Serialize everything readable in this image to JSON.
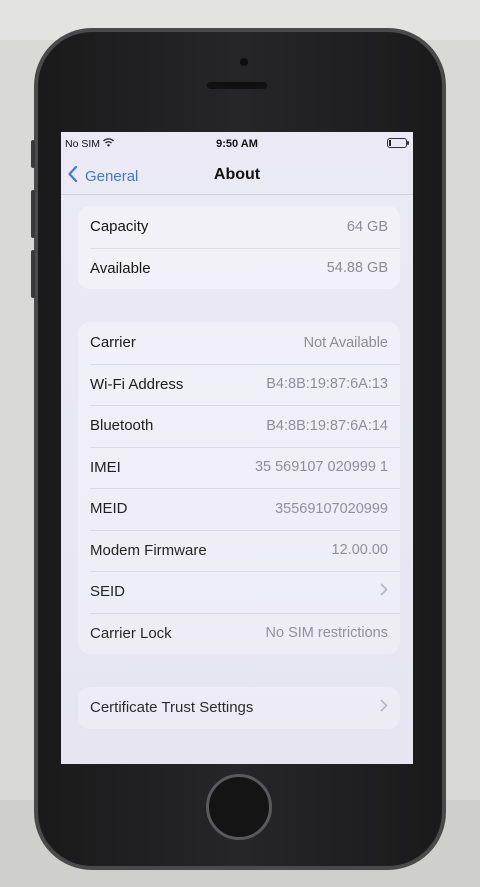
{
  "status_bar": {
    "carrier": "No SIM",
    "wifi_icon": "wifi-icon",
    "time": "9:50 AM",
    "battery_icon": "battery-icon"
  },
  "nav": {
    "back_label": "General",
    "title": "About"
  },
  "storage": [
    {
      "label": "Capacity",
      "value": "64 GB"
    },
    {
      "label": "Available",
      "value": "54.88 GB"
    }
  ],
  "network": [
    {
      "label": "Carrier",
      "value": "Not Available"
    },
    {
      "label": "Wi-Fi Address",
      "value": "B4:8B:19:87:6A:13"
    },
    {
      "label": "Bluetooth",
      "value": "B4:8B:19:87:6A:14"
    },
    {
      "label": "IMEI",
      "value": "35 569107 020999 1"
    },
    {
      "label": "MEID",
      "value": "35569107020999"
    },
    {
      "label": "Modem Firmware",
      "value": "12.00.00"
    },
    {
      "label": "SEID",
      "value": ""
    },
    {
      "label": "Carrier Lock",
      "value": "No SIM restrictions"
    }
  ],
  "certificate": {
    "label": "Certificate Trust Settings"
  },
  "colors": {
    "accent": "#3a78e8",
    "screen_bg": "#ebeaf4",
    "group_bg": "#f3f2f9",
    "secondary_text": "#8b8a93"
  }
}
